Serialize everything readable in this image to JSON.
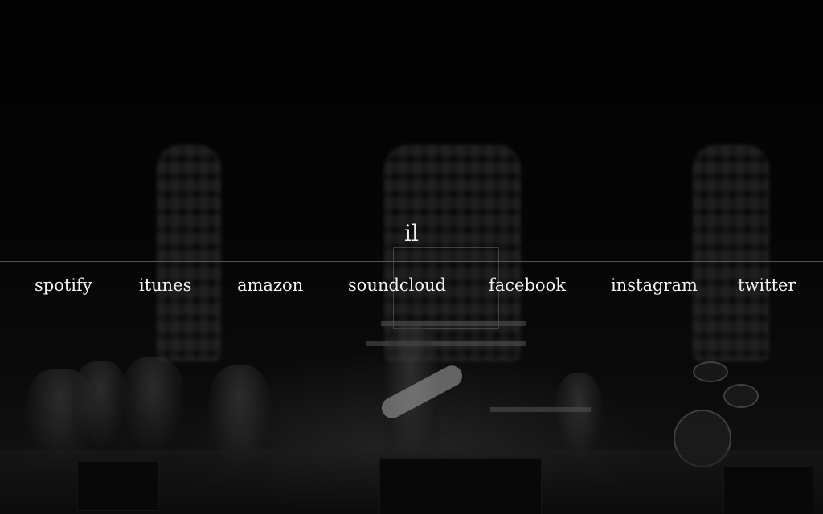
{
  "site": {
    "logo_text": "il"
  },
  "nav": {
    "links": [
      {
        "label": "spotify"
      },
      {
        "label": "itunes"
      },
      {
        "label": "amazon"
      },
      {
        "label": "soundcloud"
      },
      {
        "label": "facebook"
      },
      {
        "label": "instagram"
      },
      {
        "label": "twitter"
      }
    ]
  },
  "background": {
    "description_icon": "concert-stage-photo",
    "tone": "#000000"
  }
}
